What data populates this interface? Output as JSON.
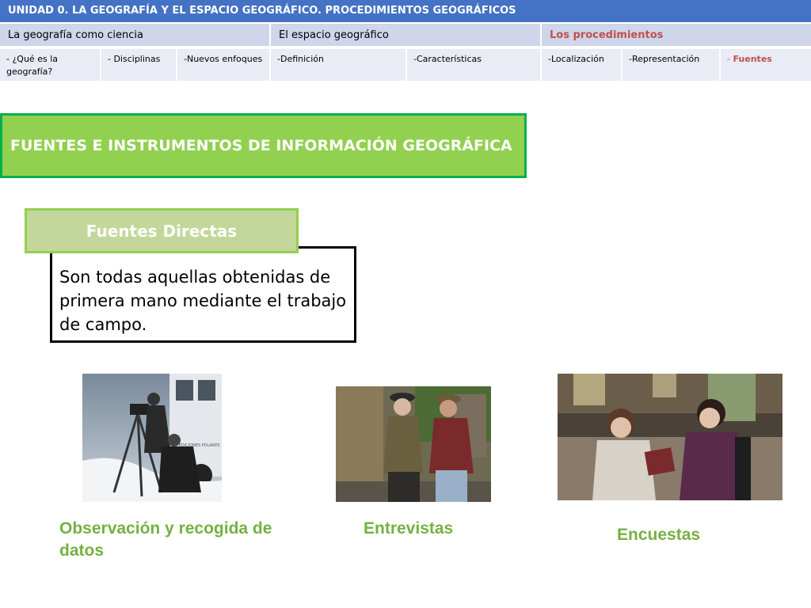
{
  "nav": {
    "unit_title": "UNIDAD 0.  LA GEOGRAFÍA Y EL ESPACIO GEOGRÁFICO. PROCEDIMIENTOS GEOGRÁFICOS",
    "sections": [
      {
        "label": "La geografía como ciencia"
      },
      {
        "label": "El espacio geográfico"
      },
      {
        "label": "Los procedimientos"
      }
    ],
    "subsections": [
      {
        "label": "-  ¿Qué es la geografía?"
      },
      {
        "label": "- Disciplinas"
      },
      {
        "label": "-Nuevos enfoques"
      },
      {
        "label": "-Definición"
      },
      {
        "label": "-Características"
      },
      {
        "label": "-Localización"
      },
      {
        "label": "-Representación"
      },
      {
        "label_prefix": "- ",
        "label": "Fuentes"
      }
    ],
    "colors": {
      "header": "#4472c4",
      "section": "#cfd5ea",
      "subsection": "#e9ebf5",
      "active": "#c0504d"
    }
  },
  "main": {
    "title": "FUENTES E INSTRUMENTOS DE INFORMACIÓN GEOGRÁFICA",
    "label": "Fuentes Directas",
    "definition": "Son todas aquellas obtenidas de primera mano mediante el trabajo de campo.",
    "photos": [
      {
        "caption": "Observación y recogida de datos",
        "icon": "surveyor-photo",
        "vehicle_text": "EXPEDICIONES POLARES"
      },
      {
        "caption": "Entrevistas",
        "icon": "interview-photo"
      },
      {
        "caption": "Encuestas",
        "icon": "survey-photo"
      }
    ],
    "colors": {
      "title_fill": "#92d050",
      "title_border": "#00b050",
      "label_fill": "#c4d79b",
      "caption": "#76b043"
    }
  }
}
